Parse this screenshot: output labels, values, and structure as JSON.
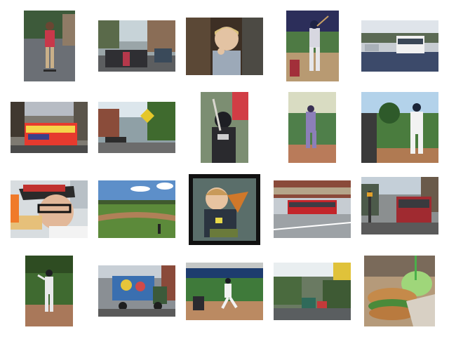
{
  "gallery": {
    "images": [
      {
        "subject": "skateboarder-on-street"
      },
      {
        "subject": "street-crowd-under-trees"
      },
      {
        "subject": "toddler-eating-at-table"
      },
      {
        "subject": "baseball-batter-swinging-with-catcher"
      },
      {
        "subject": "city-bus-on-road"
      },
      {
        "subject": "colorful-trolley-on-city-street"
      },
      {
        "subject": "street-with-pedestrian-crossing-sign"
      },
      {
        "subject": "young-baseball-batter-in-helmet"
      },
      {
        "subject": "baseball-pitcher-throwing"
      },
      {
        "subject": "baseball-batter-at-plate"
      },
      {
        "subject": "man-with-glasses-eating-hotdog"
      },
      {
        "subject": "baseball-field-under-sky"
      },
      {
        "subject": "child-eating-pizza"
      },
      {
        "subject": "red-bus-on-city-street"
      },
      {
        "subject": "red-trolley-bus-in-city"
      },
      {
        "subject": "baseball-pitcher-on-mound"
      },
      {
        "subject": "painted-truck-on-street"
      },
      {
        "subject": "baseball-batter-running-with-catcher"
      },
      {
        "subject": "street-with-vehicles-and-trees"
      },
      {
        "subject": "sandwich-with-green-drink"
      }
    ]
  }
}
